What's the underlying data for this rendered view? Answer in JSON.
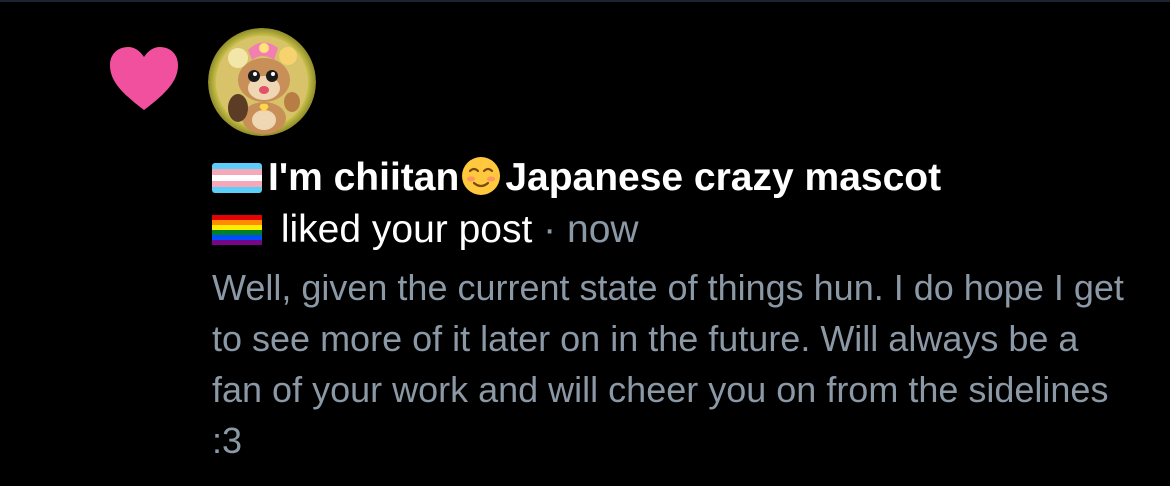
{
  "notification": {
    "type_icon": "heart-icon",
    "accent_color": "#f0509d",
    "avatar": "user-avatar",
    "user_name_part1": "I'm chiitan",
    "user_name_part2": "Japanese crazy mascot",
    "name_flags": [
      "transgender-flag-emoji",
      "smiling-face-emoji",
      "rainbow-flag-emoji"
    ],
    "action_text": "liked your post",
    "separator": "·",
    "time": "now",
    "message": "Well, given the current state of things hun. I do hope I get to see more of it later on in the future. Will always be a fan of your work and will cheer you on from the sidelines :3",
    "text_color": "#ffffff",
    "secondary_color": "#8b98a5"
  }
}
